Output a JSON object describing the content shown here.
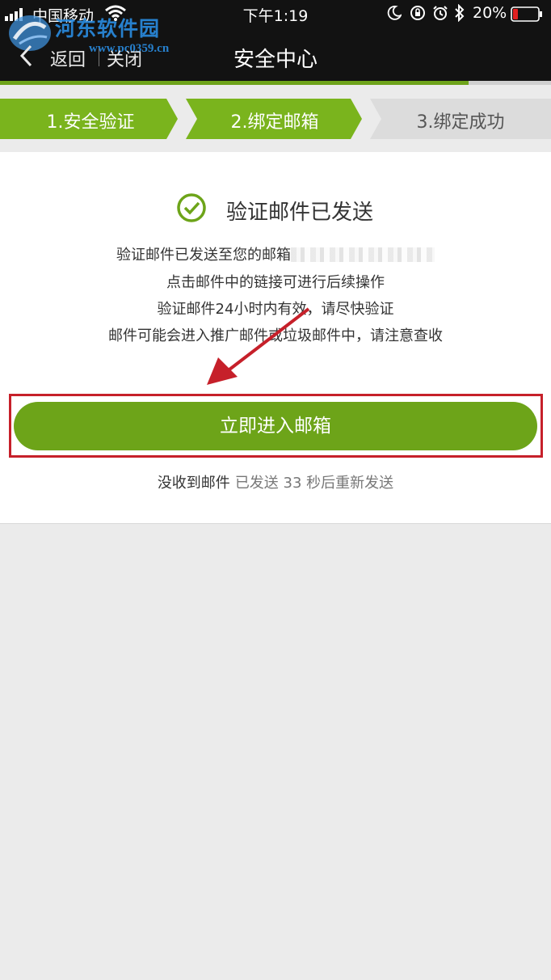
{
  "status_bar": {
    "carrier": "中国移动",
    "time": "下午1:19",
    "battery_percent": "20%",
    "battery_level": 0.2,
    "battery_color": "#e02020"
  },
  "watermark": {
    "name": "河东软件园",
    "url": "www.pc0359.cn"
  },
  "nav": {
    "back_label": "返回",
    "close_label": "关闭",
    "title": "安全中心",
    "progress": 0.85
  },
  "steps": [
    {
      "label": "1.安全验证",
      "state": "done"
    },
    {
      "label": "2.绑定邮箱",
      "state": "active"
    },
    {
      "label": "3.绑定成功",
      "state": "pending"
    }
  ],
  "content": {
    "heading": "验证邮件已发送",
    "line1": "验证邮件已发送至您的邮箱",
    "line2": "点击邮件中的链接可进行后续操作",
    "line3": "验证邮件24小时内有效，请尽快验证",
    "line4": "邮件可能会进入推广邮件或垃圾邮件中，请注意查收",
    "enter_button": "立即进入邮箱",
    "resend_question": "没收到邮件",
    "resend_status": "已发送 33 秒后重新发送"
  },
  "colors": {
    "accent_green": "#6da419",
    "step_active": "#7ab41d",
    "step_pending": "#dcdcdc",
    "annotation_red": "#c6202a"
  },
  "icons": {
    "check": "check-circle-icon",
    "back": "chevron-left-icon",
    "wifi": "wifi-icon",
    "bluetooth": "bluetooth-icon",
    "alarm": "alarm-icon"
  }
}
